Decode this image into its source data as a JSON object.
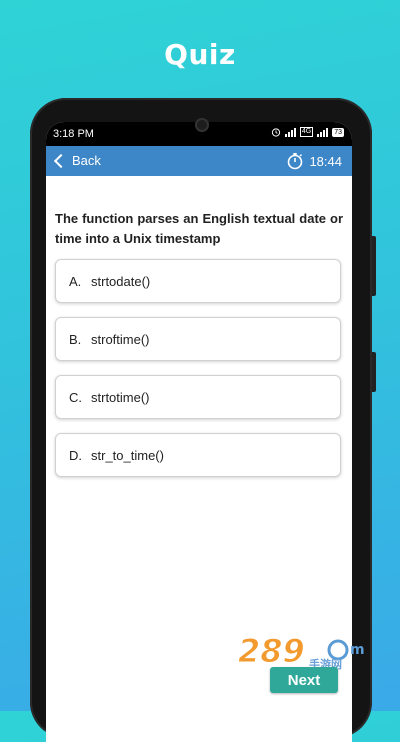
{
  "banner": {
    "title": "Quiz"
  },
  "status_bar": {
    "time": "3:18 PM",
    "sim_label": "4G",
    "battery": "73"
  },
  "app_bar": {
    "back_label": "Back",
    "timer": "18:44"
  },
  "quiz": {
    "question": "The function parses an English textual date or time into a Unix timestamp",
    "options": [
      {
        "letter": "A.",
        "text": "strtodate()"
      },
      {
        "letter": "B.",
        "text": "stroftime()"
      },
      {
        "letter": "C.",
        "text": "strtotime()"
      },
      {
        "letter": "D.",
        "text": "str_to_time()"
      }
    ]
  },
  "footer": {
    "next_label": "Next",
    "watermark_text": "手游网"
  },
  "colors": {
    "app_bar": "#3d86c8",
    "next_button": "#2fa89a",
    "background_start": "#2fd3d6",
    "background_end": "#3aa9e8"
  }
}
